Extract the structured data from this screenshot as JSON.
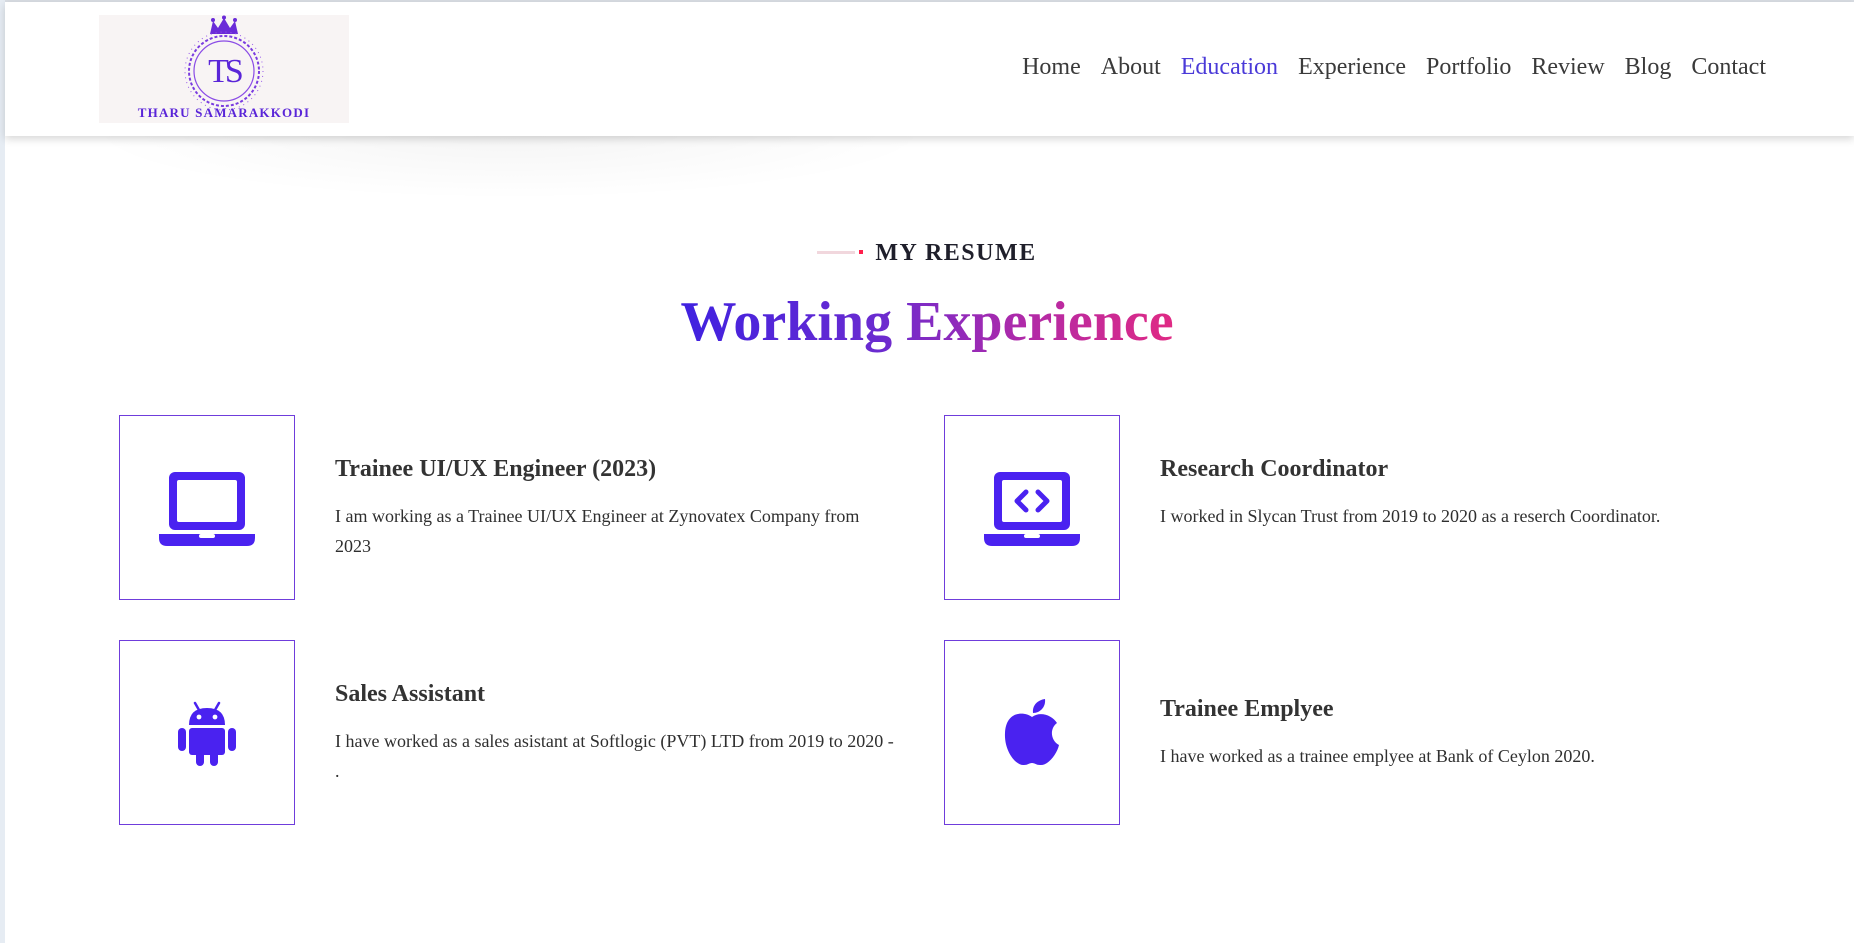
{
  "brand": {
    "monogram": "TS",
    "name": "THARU SAMARAKKODI",
    "accent": "#5a25d8"
  },
  "nav": {
    "items": [
      "Home",
      "About",
      "Education",
      "Experience",
      "Portfolio",
      "Review",
      "Blog",
      "Contact"
    ],
    "active": "Education",
    "active_color": "#4a3ad8"
  },
  "section": {
    "kicker": "MY RESUME",
    "title": "Working Experience",
    "gradient_colors": [
      "#3f21e0",
      "#e02a84"
    ]
  },
  "experience": [
    {
      "icon": "laptop-icon",
      "title": "Trainee UI/UX Engineer (2023)",
      "description": "I am working as a Trainee UI/UX Engineer at Zynovatex Company from 2023"
    },
    {
      "icon": "code-laptop-icon",
      "title": "Research Coordinator",
      "description": "I worked in Slycan Trust from 2019 to 2020 as a reserch Coordinator."
    },
    {
      "icon": "android-icon",
      "title": "Sales Assistant",
      "description": "I have worked as a sales asistant at Softlogic (PVT) LTD from 2019 to 2020 - ."
    },
    {
      "icon": "apple-icon",
      "title": "Trainee Emplyee",
      "description": "I have worked as a trainee emplyee at Bank of Ceylon 2020."
    }
  ],
  "icon_color": "#4a22f0"
}
